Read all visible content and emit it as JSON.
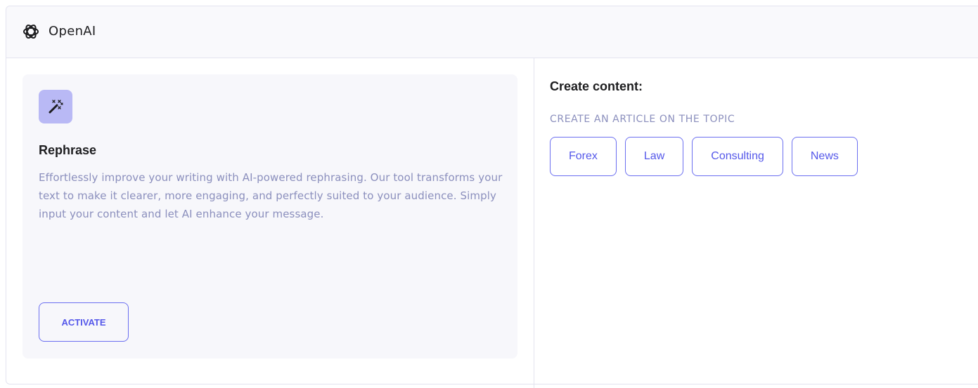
{
  "header": {
    "logo_icon": "openai-logo-icon",
    "brand": "OpenAI"
  },
  "card": {
    "icon": "magic-wand-icon",
    "title": "Rephrase",
    "description": "Effortlessly improve your writing with AI-powered rephrasing. Our tool transforms your text to make it clearer, more engaging, and perfectly suited to your audience. Simply input your content and let AI enhance your message.",
    "button_label": "ACTIVATE"
  },
  "content": {
    "title": "Create content:",
    "subtitle": "CREATE AN ARTICLE ON THE TOPIC",
    "topics": [
      "Forex",
      "Law",
      "Consulting",
      "News"
    ]
  },
  "colors": {
    "accent": "#5558ea",
    "icon_bg": "#b9b9f5",
    "muted_text": "#8b8fbd",
    "card_bg": "#f7f7fb"
  }
}
